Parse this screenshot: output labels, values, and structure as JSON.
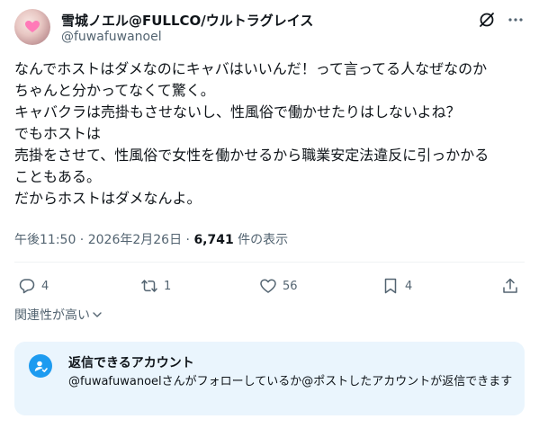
{
  "author": {
    "display_name": "雪城ノエル@FULLCO/ウルトラグレイス",
    "handle": "@fuwafuwanoel"
  },
  "tweet": {
    "lines": [
      "なんでホストはダメなのにキャバはいいんだ！って言ってる人なぜなのか",
      "ちゃんと分かってなくて驚く。",
      "キャバクラは売掛もさせないし、性風俗で働かせたりはしないよね？",
      "でもホストは",
      "売掛をさせて、性風俗で女性を働かせるから職業安定法違反に引っかかる",
      "こともある。",
      "だからホストはダメなんよ。"
    ]
  },
  "meta": {
    "time": "午後11:50",
    "separator1": " · ",
    "date": "2026年2月26日",
    "separator2": " · ",
    "views": "6,741",
    "views_label": " 件の表示"
  },
  "actions": {
    "replies": "4",
    "reposts": "1",
    "likes": "56",
    "bookmarks": "4"
  },
  "relevance_label": "関連性が高い",
  "reply_restriction": {
    "title": "返信できるアカウント",
    "description": "@fuwafuwanoelさんがフォローしているか@ポストしたアカウントが返信できます"
  },
  "colors": {
    "text": "#0f1419",
    "secondary": "#536471",
    "accent": "#1d9bf0",
    "reply_box_bg": "#eaf5fd"
  }
}
